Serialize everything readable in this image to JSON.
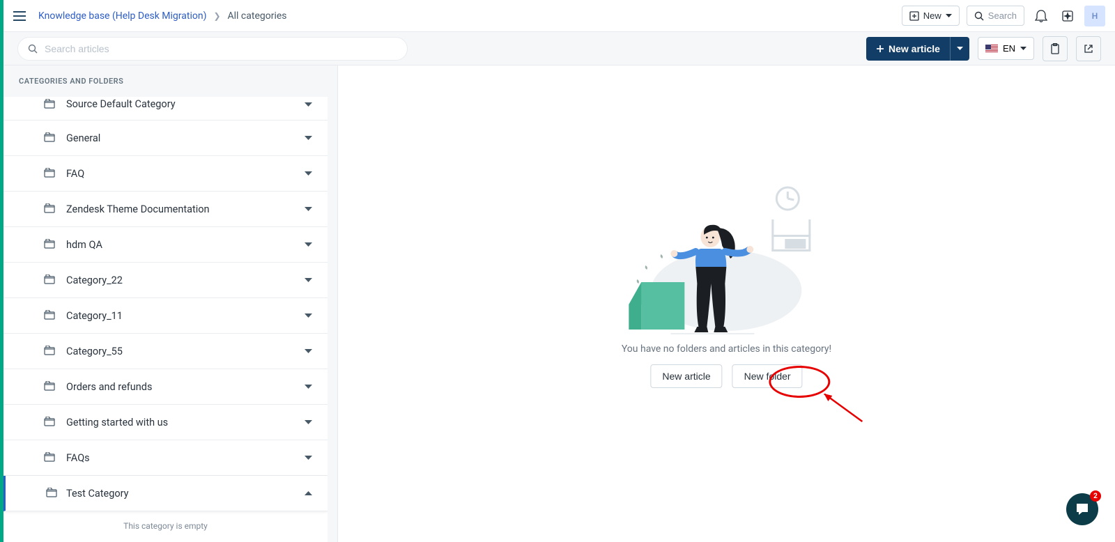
{
  "breadcrumb": {
    "root": "Knowledge base (Help Desk Migration)",
    "current": "All categories"
  },
  "top": {
    "new_label": "New",
    "search_placeholder": "Search",
    "avatar_initial": "H"
  },
  "subbar": {
    "search_placeholder": "Search articles",
    "new_article": "New article",
    "lang": "EN"
  },
  "sidebar": {
    "header": "CATEGORIES AND FOLDERS",
    "categories": [
      {
        "label": "Source Default Category",
        "active": false,
        "half": true
      },
      {
        "label": "General",
        "active": false
      },
      {
        "label": "FAQ",
        "active": false
      },
      {
        "label": "Zendesk Theme Documentation",
        "active": false
      },
      {
        "label": "hdm QA",
        "active": false
      },
      {
        "label": "Category_22",
        "active": false
      },
      {
        "label": "Category_11",
        "active": false
      },
      {
        "label": "Category_55",
        "active": false
      },
      {
        "label": "Orders and refunds",
        "active": false
      },
      {
        "label": "Getting started with us",
        "active": false
      },
      {
        "label": "FAQs",
        "active": false
      },
      {
        "label": "Test Category",
        "active": true
      }
    ],
    "empty_text": "This category is empty"
  },
  "main": {
    "empty_message": "You have no folders and articles in this category!",
    "new_article": "New article",
    "new_folder": "New folder"
  },
  "chat": {
    "badge": "2"
  }
}
